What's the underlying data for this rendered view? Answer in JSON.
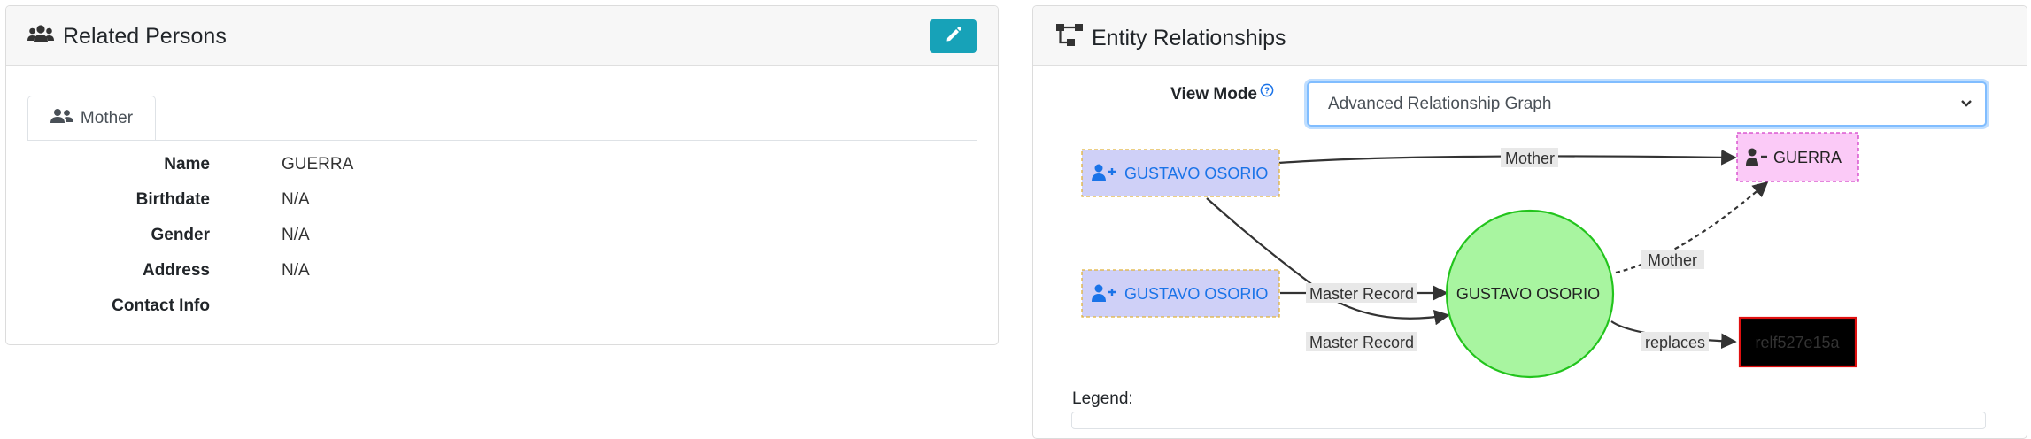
{
  "related_persons": {
    "title": "Related Persons",
    "tab_label": "Mother",
    "fields": [
      {
        "label": "Name",
        "value": "GUERRA"
      },
      {
        "label": "Birthdate",
        "value": "N/A"
      },
      {
        "label": "Gender",
        "value": "N/A"
      },
      {
        "label": "Address",
        "value": "N/A"
      },
      {
        "label": "Contact Info",
        "value": ""
      }
    ]
  },
  "entity_relationships": {
    "title": "Entity Relationships",
    "view_mode_label": "View Mode",
    "view_mode_value": "Advanced Relationship Graph",
    "legend_label": "Legend:",
    "graph": {
      "nodes": {
        "person1": "GUSTAVO OSORIO",
        "person2": "GUSTAVO OSORIO",
        "master": "GUSTAVO OSORIO",
        "guerra": "GUERRA",
        "ref": "relf527e15a"
      },
      "edges": {
        "mother_top": "Mother",
        "master_record_1": "Master Record",
        "master_record_2": "Master Record",
        "mother_dotted": "Mother",
        "replaces": "replaces"
      }
    }
  },
  "colors": {
    "accent_teal": "#17a2b8",
    "link_blue": "#1a73e8",
    "person_fill": "#cfd0f7",
    "guerra_fill": "#fbcaf7",
    "master_fill": "#a8f5a0",
    "master_stroke": "#22c41c",
    "ref_stroke": "#e01010"
  }
}
